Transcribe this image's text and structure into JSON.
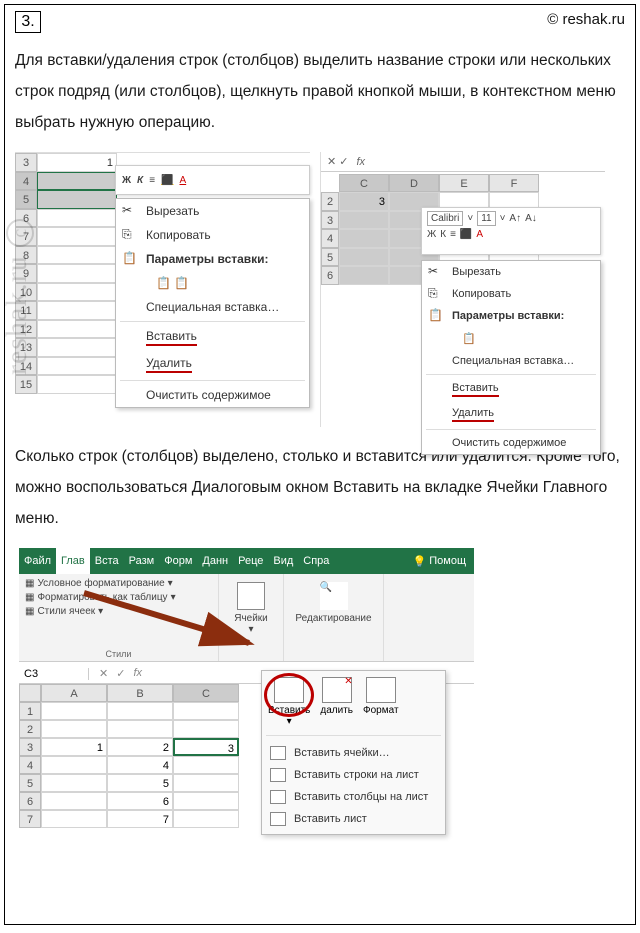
{
  "header": {
    "question_number": "3.",
    "source": "© reshak.ru"
  },
  "paragraph1": "Для вставки/удаления строк (столбцов) выделить название строки или нескольких строк подряд (или столбцов), щелкнуть правой кнопкой мыши, в контекстном меню выбрать нужную операцию.",
  "shot1": {
    "rows": [
      "3",
      "4",
      "5",
      "6",
      "7",
      "8",
      "9",
      "10",
      "11",
      "12",
      "13",
      "14",
      "15"
    ],
    "cell_value": "1",
    "ctx": {
      "cut": "Вырезать",
      "copy": "Копировать",
      "paste_options": "Параметры вставки:",
      "paste_special": "Специальная вставка…",
      "insert": "Вставить",
      "delete": "Удалить",
      "clear": "Очистить содержимое"
    },
    "mini": {
      "bold": "Ж",
      "italic": "К"
    }
  },
  "shot2": {
    "cols": [
      "C",
      "D",
      "E",
      "F"
    ],
    "rows": [
      "2",
      "3",
      "4",
      "5",
      "6"
    ],
    "cell_value": "3",
    "mini_font": "Calibri",
    "mini_size": "11",
    "ctx": {
      "cut": "Вырезать",
      "copy": "Копировать",
      "paste_options": "Параметры вставки:",
      "paste_special": "Специальная вставка…",
      "insert": "Вставить",
      "delete": "Удалить",
      "clear": "Очистить содержимое"
    }
  },
  "paragraph2": "Сколько строк (столбцов) выделено, столько и вставится или удалится. Кроме того, можно воспользоваться Диалоговым окном Вставить на вкладке Ячейки Главного меню.",
  "shot3": {
    "tabs": [
      "Файл",
      "Глав",
      "Вста",
      "Разм",
      "Форм",
      "Данн",
      "Реце",
      "Вид",
      "Спра"
    ],
    "help": "Помощ",
    "styles_group": {
      "cond_format": "Условное форматирование",
      "as_table": "Форматировать как таблицу",
      "cell_styles": "Стили ячеек",
      "label": "Стили"
    },
    "cells_group": {
      "label": "Ячейки"
    },
    "editing_group": {
      "label": "Редактирование"
    },
    "namebox": "C3",
    "cols": [
      "A",
      "B",
      "C"
    ],
    "rows": [
      "1",
      "2",
      "3",
      "4",
      "5",
      "6",
      "7"
    ],
    "row3_vals": [
      "1",
      "2",
      "3"
    ],
    "row_other_vals": {
      "4": "4",
      "5": "5",
      "6": "6",
      "7": "7"
    },
    "dropdown": {
      "insert_btn": "Вставить",
      "delete_btn": "далить",
      "format_btn": "Формат",
      "insert_cells": "Вставить ячейки…",
      "insert_rows": "Вставить строки на лист",
      "insert_cols": "Вставить столбцы на лист",
      "insert_sheet": "Вставить лист"
    }
  },
  "watermark": {
    "text": "reshak.ru",
    "c": "c"
  }
}
